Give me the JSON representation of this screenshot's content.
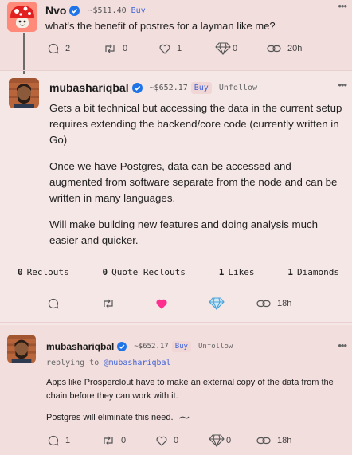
{
  "top_post": {
    "username": "Nvo",
    "price": "~$511.40",
    "buy_label": "Buy",
    "text": "what's the benefit of postres for a layman like me?",
    "comments": "2",
    "reclouts": "0",
    "likes": "1",
    "diamonds": "0",
    "time": "20h"
  },
  "main_post": {
    "username": "mubashariqbal",
    "price": "~$652.17",
    "buy_label": "Buy",
    "unfollow_label": "Unfollow",
    "paragraphs": [
      "Gets a bit technical but accessing the data in the current setup requires extending the backend/core code (currently written in Go)",
      "Once we have Postgres, data can be accessed and augmented from software separate from the node and can be written in many languages.",
      "Will make building new features and doing analysis much easier and quicker."
    ],
    "stats": {
      "reclouts_count": "0",
      "reclouts_label": "Reclouts",
      "quote_count": "0",
      "quote_label": "Quote Reclouts",
      "likes_count": "1",
      "likes_label": "Likes",
      "diamonds_count": "1",
      "diamonds_label": "Diamonds"
    },
    "time": "18h",
    "liked": true
  },
  "reply_post": {
    "username": "mubashariqbal",
    "price": "~$652.17",
    "buy_label": "Buy",
    "unfollow_label": "Unfollow",
    "replying_prefix": "replying to",
    "replying_to": "@mubashariqbal",
    "paragraphs": [
      "Apps like Prosperclout have to make an external copy of the data from the chain before they can work with it.",
      "Postgres will eliminate this need."
    ],
    "comments": "1",
    "reclouts": "0",
    "likes": "0",
    "diamonds": "0",
    "time": "18h"
  },
  "colors": {
    "background": "#f6e7e7",
    "verify_blue": "#1f74e8",
    "link_blue": "#3f62d8",
    "heart_pink": "#ff2f8f",
    "diamond_blue": "#4aa3d9"
  },
  "icons": [
    "comment-icon",
    "reclout-icon",
    "heart-icon",
    "diamond-icon",
    "link-icon",
    "verified-icon",
    "more-icon"
  ]
}
